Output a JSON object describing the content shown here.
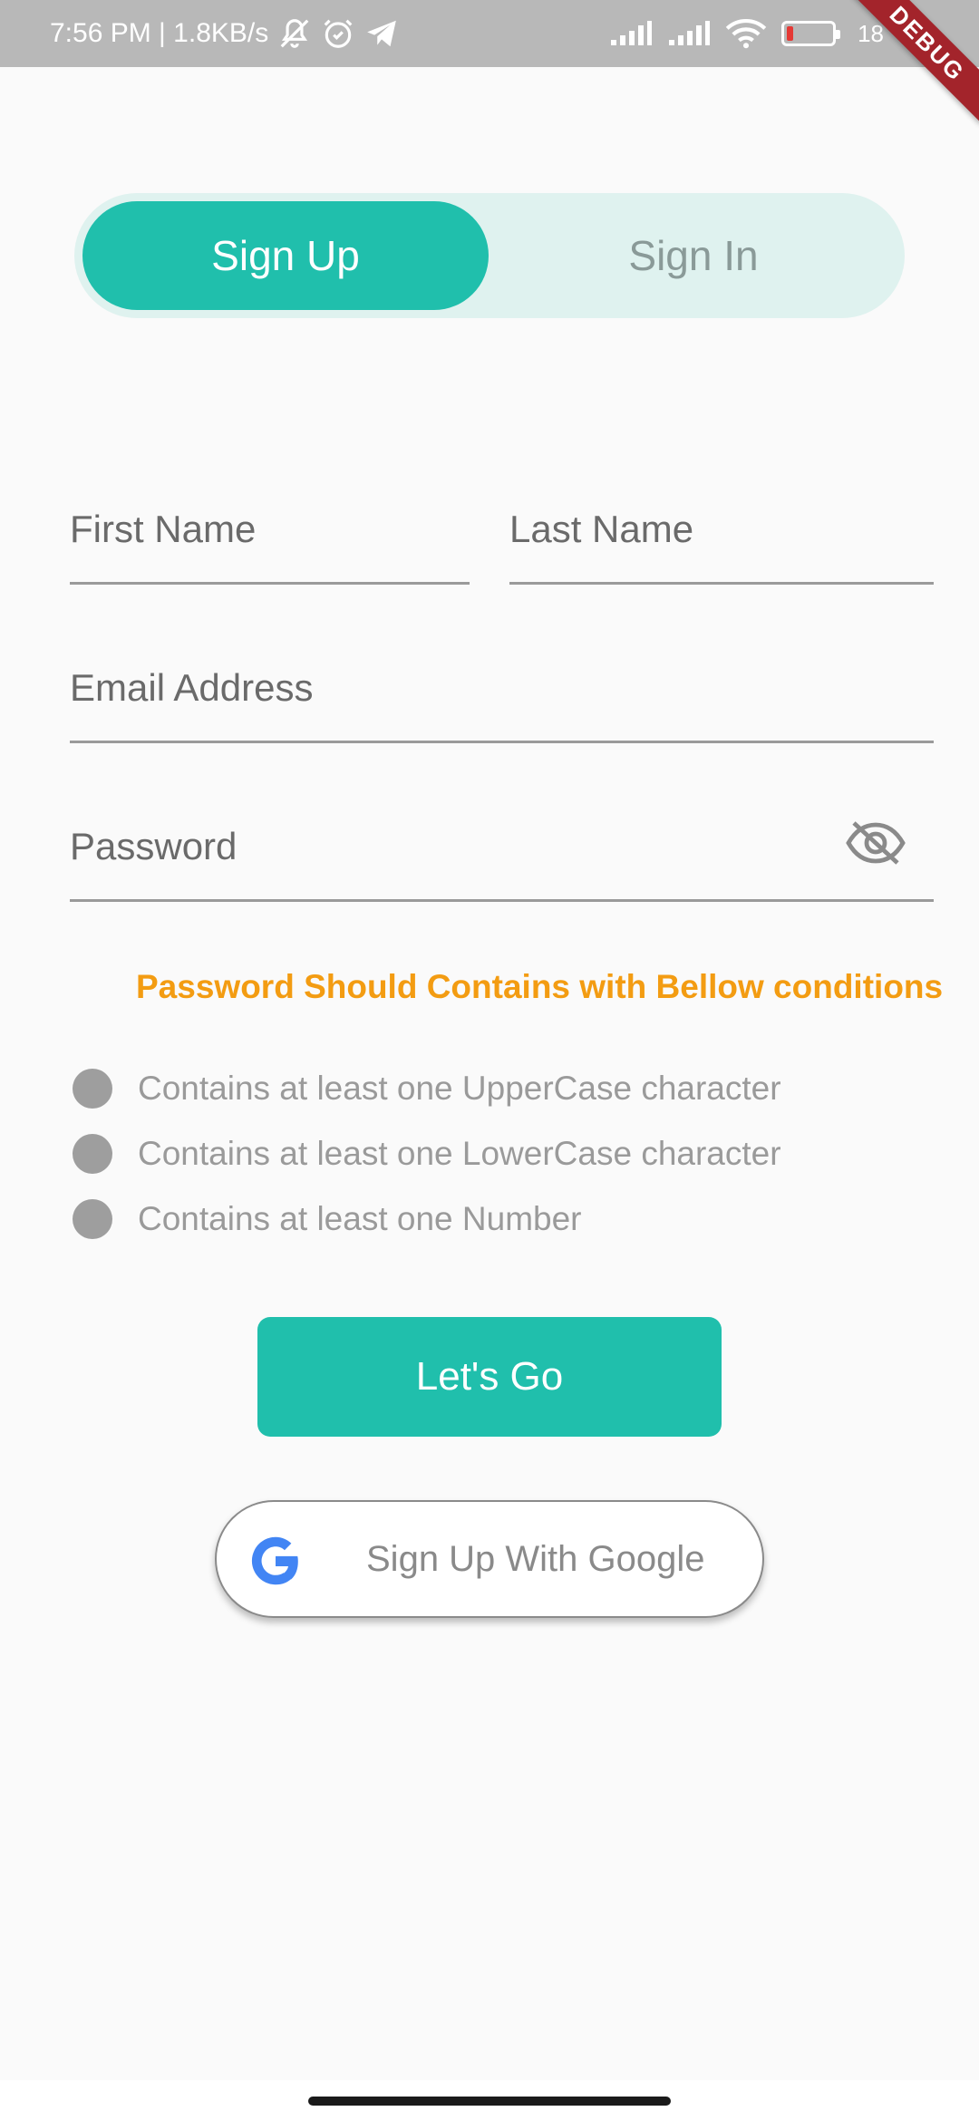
{
  "status_bar": {
    "time_network": "7:56 PM | 1.8KB/s",
    "battery_level": "18",
    "battery_fraction": 0.14,
    "icons": [
      "bell-off-icon",
      "alarm-icon",
      "telegram-icon",
      "signal-icon",
      "signal-icon",
      "wifi-icon",
      "battery-icon"
    ]
  },
  "debug_banner": "DEBUG",
  "toggle": {
    "sign_up_label": "Sign Up",
    "sign_in_label": "Sign In",
    "active": "Sign Up"
  },
  "form": {
    "first_name_placeholder": "First Name",
    "last_name_placeholder": "Last Name",
    "email_placeholder": "Email Address",
    "password_placeholder": "Password",
    "password_visibility_icon": "eye-off-icon"
  },
  "password_rules": {
    "heading": "Password Should Contains with Bellow conditions",
    "items": [
      "Contains at least one UpperCase character",
      "Contains at least one LowerCase character",
      "Contains at least one Number"
    ]
  },
  "buttons": {
    "submit_label": "Let's Go",
    "google_label": "Sign Up With Google"
  },
  "colors": {
    "accent": "#20bfac",
    "toggle_track": "#dff2ef",
    "warning": "#f39c12",
    "status_bar": "#b8b8b8",
    "debug_ribbon": "#a3242b"
  }
}
